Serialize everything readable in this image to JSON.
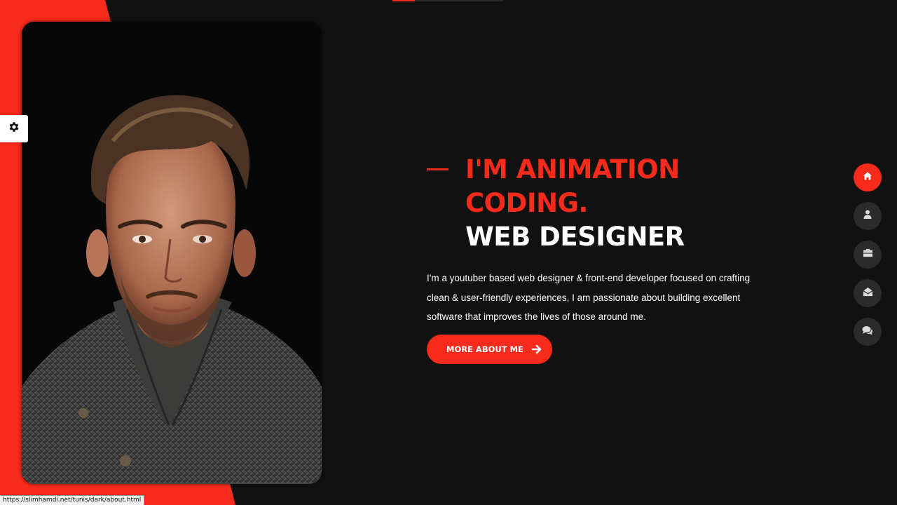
{
  "progress": {
    "fraction": 0.2
  },
  "hero": {
    "line1": "I'M ANIMATION",
    "line2": "CODING.",
    "line3": "WEB DESIGNER",
    "description": "I'm a youtuber based web designer & front-end developer focused on crafting clean & user-friendly experiences, I am passionate about building excellent software that improves the lives of those around me.",
    "cta_label": "MORE ABOUT ME"
  },
  "nav": {
    "items": [
      {
        "icon": "home-icon",
        "active": true
      },
      {
        "icon": "user-icon",
        "active": false
      },
      {
        "icon": "briefcase-icon",
        "active": false
      },
      {
        "icon": "envelope-open-icon",
        "active": false
      },
      {
        "icon": "comments-icon",
        "active": false
      }
    ]
  },
  "settings": {
    "icon": "gear-icon"
  },
  "status_bar": {
    "url": "https://slimhamdi.net/tunis/dark/about.html"
  },
  "colors": {
    "accent": "#f72b1c",
    "background": "#111111",
    "nav_button": "#2b2b2b"
  }
}
